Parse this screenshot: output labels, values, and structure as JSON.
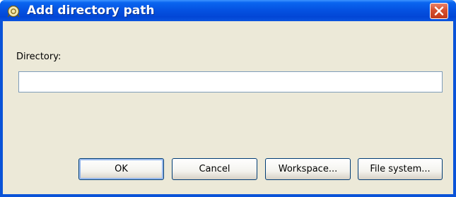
{
  "window": {
    "title": "Add directory path",
    "icon": "eclipse-path-icon",
    "close_icon": "close-icon"
  },
  "form": {
    "directory_label": "Directory:",
    "directory_value": "",
    "directory_placeholder": ""
  },
  "buttons": {
    "ok": "OK",
    "cancel": "Cancel",
    "workspace": "Workspace...",
    "file_system": "File system..."
  },
  "colors": {
    "titlebar": "#0553e2",
    "client_background": "#ece9d8",
    "close_button": "#d6502f",
    "button_border": "#003c74"
  }
}
